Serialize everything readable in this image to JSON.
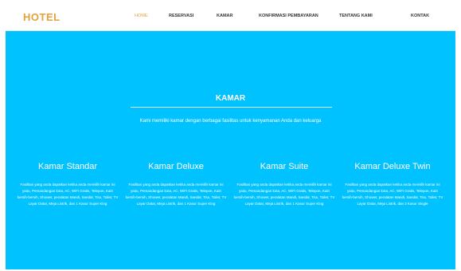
{
  "brand": "HOTEL",
  "nav": [
    {
      "label": "HOME",
      "active": true
    },
    {
      "label": "RESERVASI",
      "active": false
    },
    {
      "label": "KAMAR",
      "active": false
    },
    {
      "label": "KONFIRMASI PEMBAYARAN",
      "active": false
    },
    {
      "label": "TENTANG KAMI",
      "active": false
    },
    {
      "label": "KONTAK",
      "active": false
    }
  ],
  "section": {
    "title": "KAMAR",
    "subtitle": "Kami memiliki kamar dengan berbagai fasilitas untuk kenyamanan Anda dan keluarga"
  },
  "rooms": [
    {
      "name": "Kamar Standar",
      "desc": "Fasilitas yang anda dapatkan ketika anda memilih kamar ini yaitu, Pemandangan kota, AC, WiFi Gratis, Telepon, Kain bersih-bersih, Shower, peralatan Mandi, Sandal, Tisu, Toilet, TV Layar Datar, Meja Listrik, dan 1 Kasur Super King"
    },
    {
      "name": "Kamar Deluxe",
      "desc": "Fasilitas yang anda dapatkan ketika anda memilih kamar ini yaitu, Pemandangan kota, AC, WiFi Gratis, Telepon, Kain bersih-bersih, Shower, peralatan Mandi, Sandal, Tisu, Toilet, TV Layar Datar, Meja Listrik, dan 1 Kasur Super King"
    },
    {
      "name": "Kamar Suite",
      "desc": "Fasilitas yang anda dapatkan ketika anda memilih kamar ini yaitu, Pemandangan kota, AC, WiFi Gratis, Telepon, Kain bersih-bersih, Shower, peralatan Mandi, Sandal, Tisu, Toilet, TV Layar Datar, Meja Listrik, dan 1 Kasur Super King"
    },
    {
      "name": "Kamar Deluxe Twin",
      "desc": "Fasilitas yang anda dapatkan ketika anda memilih kamar ini yaitu, Pemandangan kota, AC, WiFi Gratis, Telepon, Kain bersih-bersih, Shower, peralatan Mandi, Sandal, Tisu, Toilet, TV Layar Datar, Meja Listrik, dan 2 Kasur Single"
    }
  ],
  "colors": {
    "accent": "#e3a23a",
    "background": "#00c2ff",
    "nav_bg": "#ffffff"
  }
}
